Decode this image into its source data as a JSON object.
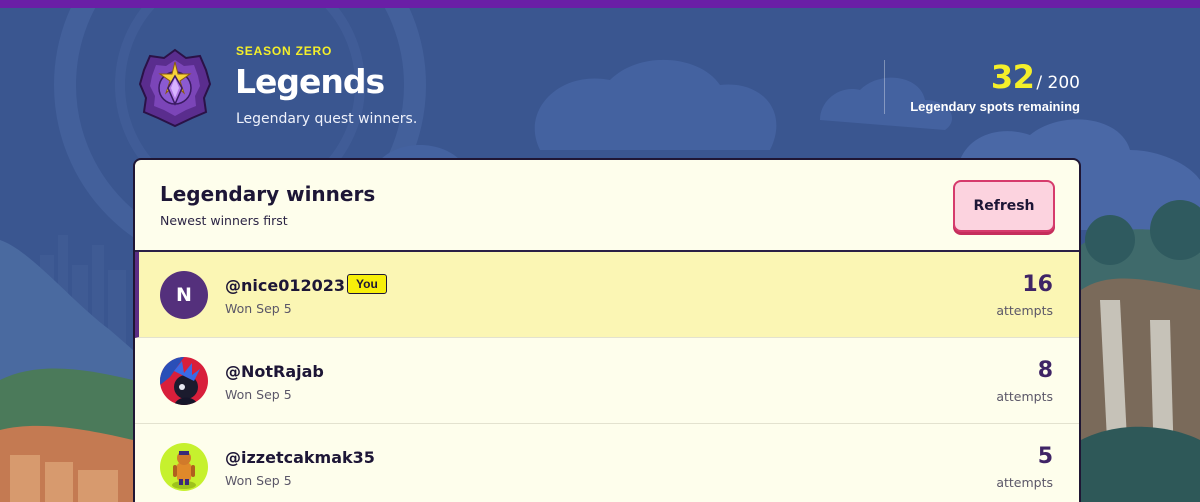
{
  "header": {
    "season": "SEASON ZERO",
    "title": "Legends",
    "subtitle": "Legendary quest winners.",
    "spots_remaining": "32",
    "spots_total": "/ 200",
    "spots_label": "Legendary spots remaining"
  },
  "panel": {
    "title": "Legendary winners",
    "subtitle": "Newest winners first",
    "refresh_label": "Refresh"
  },
  "winners": [
    {
      "username": "@nice012023",
      "you_badge": "You",
      "avatar_letter": "N",
      "won": "Won Sep 5",
      "attempts": "16",
      "attempts_label": "attempts"
    },
    {
      "username": "@NotRajab",
      "won": "Won Sep 5",
      "attempts": "8",
      "attempts_label": "attempts"
    },
    {
      "username": "@izzetcakmak35",
      "won": "Won Sep 5",
      "attempts": "5",
      "attempts_label": "attempts"
    }
  ],
  "colors": {
    "accent_yellow": "#f4ef2a",
    "brand_purple": "#6a1ea6",
    "highlight_row": "#fbf6b4",
    "refresh_pink": "#fcd3df"
  }
}
